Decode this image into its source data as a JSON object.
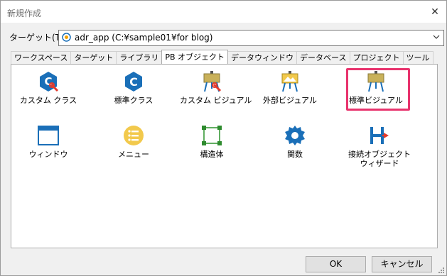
{
  "dialog": {
    "title": "新規作成",
    "close_glyph": "✕"
  },
  "target": {
    "label": "ターゲット(T):",
    "value": "adr_app (C:¥sample01¥for blog)",
    "icon": "target-app-icon"
  },
  "tabs": [
    {
      "label": "ワークスペース"
    },
    {
      "label": "ターゲット"
    },
    {
      "label": "ライブラリ"
    },
    {
      "label": "PB オブジェクト",
      "active": true
    },
    {
      "label": "データウィンドウ"
    },
    {
      "label": "データベース"
    },
    {
      "label": "プロジェクト"
    },
    {
      "label": "ツール"
    }
  ],
  "items": [
    {
      "label": "カスタム クラス",
      "icon": "custom-class-icon"
    },
    {
      "label": "標準クラス",
      "icon": "standard-class-icon"
    },
    {
      "label": "カスタム ビジュアル",
      "icon": "custom-visual-icon"
    },
    {
      "label": "外部ビジュアル",
      "icon": "external-visual-icon"
    },
    {
      "label": "標準ビジュアル",
      "icon": "standard-visual-icon",
      "highlighted": true
    },
    {
      "label": "ウィンドウ",
      "icon": "window-icon"
    },
    {
      "label": "メニュー",
      "icon": "menu-icon"
    },
    {
      "label": "構造体",
      "icon": "structure-icon"
    },
    {
      "label": "関数",
      "icon": "function-icon"
    },
    {
      "label": "接続オブジェクト\nウィザード",
      "icon": "connection-wizard-icon"
    }
  ],
  "buttons": {
    "ok": "OK",
    "cancel": "キャンセル"
  },
  "colors": {
    "accent_blue": "#1a6fb8",
    "highlight": "#e8336d",
    "easel_yellow": "#f2c94c"
  }
}
